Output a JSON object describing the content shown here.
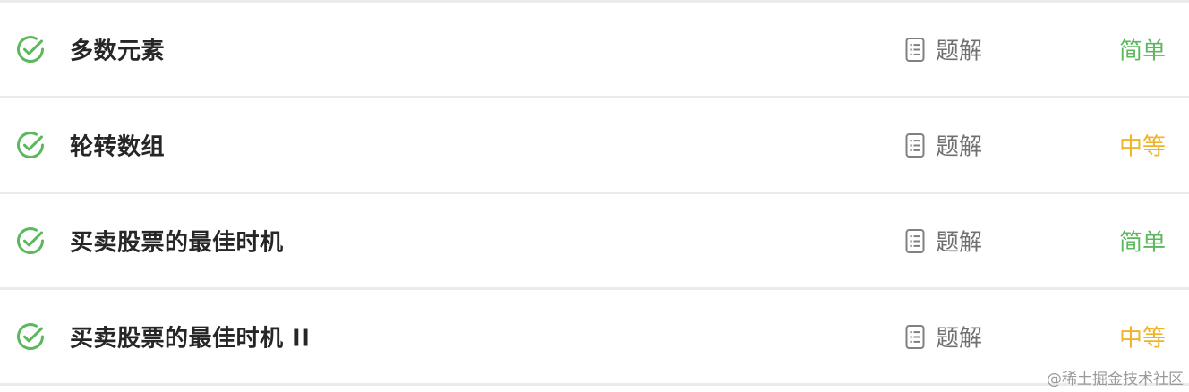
{
  "colors": {
    "check": "#5cb85c",
    "easy": "#5cb85c",
    "medium": "#f0b429",
    "muted": "#707070",
    "divider": "#ebebeb"
  },
  "problems": [
    {
      "title": "多数元素",
      "solution_label": "题解",
      "difficulty": "简单",
      "difficulty_level": "easy",
      "status_icon": "check-circle-icon"
    },
    {
      "title": "轮转数组",
      "solution_label": "题解",
      "difficulty": "中等",
      "difficulty_level": "medium",
      "status_icon": "check-circle-icon"
    },
    {
      "title": "买卖股票的最佳时机",
      "solution_label": "题解",
      "difficulty": "简单",
      "difficulty_level": "easy",
      "status_icon": "check-circle-icon"
    },
    {
      "title": "买卖股票的最佳时机 II",
      "solution_label": "题解",
      "difficulty": "中等",
      "difficulty_level": "medium",
      "status_icon": "check-circle-icon"
    }
  ],
  "watermark": "@稀土掘金技术社区"
}
